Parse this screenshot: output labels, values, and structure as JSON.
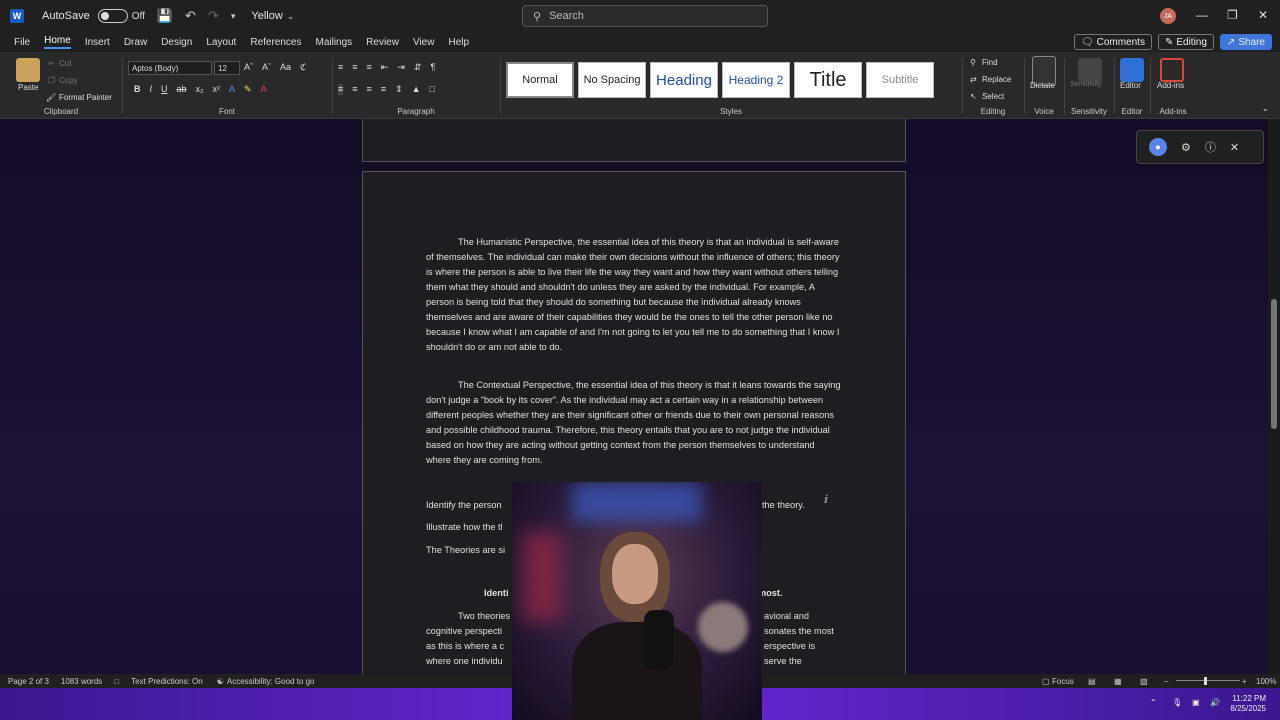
{
  "titlebar": {
    "autosave_label": "AutoSave",
    "autosave_state": "Off",
    "doc_name": "Yellow",
    "search_placeholder": "Search",
    "avatar_initials": "JA"
  },
  "menu": {
    "tabs": [
      "File",
      "Home",
      "Insert",
      "Draw",
      "Design",
      "Layout",
      "References",
      "Mailings",
      "Review",
      "View",
      "Help"
    ],
    "comments_label": "Comments",
    "editing_label": "Editing",
    "share_label": "Share"
  },
  "ribbon": {
    "clipboard": {
      "paste": "Paste",
      "cut": "Cut",
      "copy": "Copy",
      "format_painter": "Format Painter",
      "label": "Clipboard"
    },
    "font": {
      "name": "Aptos (Body)",
      "size": "12",
      "label": "Font"
    },
    "paragraph": {
      "label": "Paragraph"
    },
    "styles": {
      "items": [
        "Normal",
        "No Spacing",
        "Heading",
        "Heading 2",
        "Title",
        "Subtitle"
      ],
      "label": "Styles"
    },
    "editing": {
      "find": "Find",
      "replace": "Replace",
      "select": "Select",
      "label": "Editing"
    },
    "voice": {
      "dictate": "Dictate",
      "label": "Voice"
    },
    "sensitivity": {
      "button": "Sensitivity",
      "label": "Sensitivity"
    },
    "editor": {
      "button": "Editor",
      "label": "Editor"
    },
    "addins": {
      "button": "Add-ins",
      "label": "Add-ins"
    }
  },
  "document": {
    "para1": "The Humanistic Perspective, the essential idea of this theory is that an individual is self-aware of themselves. The individual can make their own decisions without the influence of others; this theory is where the person is able to live their life the way they want and how they want without others telling them what they should and shouldn't do unless they are asked by the individual. For example, A person is being told that they should do something but because the individual already knows themselves and are aware of their capabilities they would be the ones to tell the other person like no because I know what I am capable of and I'm not going to let you tell me to do something that I know I shouldn't do or am not able to do.",
    "para2": "The Contextual Perspective, the essential idea of this theory is that it leans towards the saying don't judge a “book by its cover”. As the individual may act a certain way in a relationship between different peoples whether they are their significant other or friends due to their own personal reasons and possible childhood trauma. Therefore, this theory entails that you are to not judge the individual based on how they are acting without getting context from the person themselves to understand where they are coming from.",
    "line_identify_left": "Identify the person",
    "line_identify_right": "the theory.",
    "line_illustrate": "Illustrate how the tl",
    "line_theories": "The Theories are si",
    "heading_left": "Identi",
    "heading_right": "most.",
    "para3_l1_left": "Two theories",
    "para3_l1_right": "avioral and",
    "para3_l2_left": "cognitive perspecti",
    "para3_l2_right": "sonates the most",
    "para3_l3_left": "as this is where a c",
    "para3_l3_right": "erspective is",
    "para3_l4_left": "where one individu",
    "para3_l4_right": "serve the"
  },
  "statusbar": {
    "page": "Page 2 of 3",
    "words": "1083 words",
    "predictions": "Text Predictions: On",
    "accessibility": "Accessibility: Good to go",
    "focus": "Focus",
    "zoom": "100%"
  },
  "taskbar": {
    "time": "11:22 PM",
    "date": "8/25/2025"
  }
}
